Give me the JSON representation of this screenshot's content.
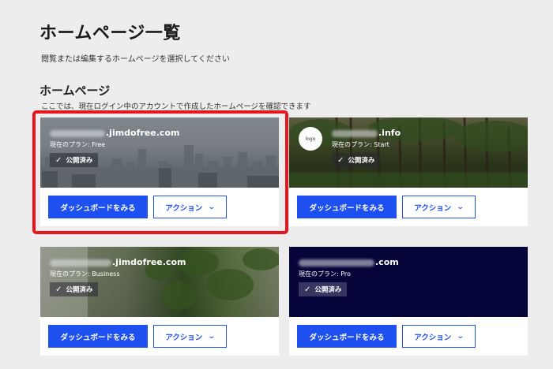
{
  "page": {
    "title": "ホームページ一覧",
    "description": "閲覧または編集するホームページを選択してください"
  },
  "section": {
    "title": "ホームページ",
    "description": "ここでは、現在ログイン中のアカウントで作成したホームページを確認できます"
  },
  "colors": {
    "accent": "#1e50f0",
    "highlight": "#e8141e",
    "background": "#ededed"
  },
  "cards": [
    {
      "domain_suffix": ".jimdofree.com",
      "plan": "現在のプラン: Free",
      "status": "公開済み",
      "dashboard_button": "ダッシュボードをみる",
      "action_button": "アクション",
      "highlighted": true
    },
    {
      "logo_text": "logo",
      "domain_suffix": ".info",
      "plan": "現在のプラン: Start",
      "status": "公開済み",
      "dashboard_button": "ダッシュボードをみる",
      "action_button": "アクション"
    },
    {
      "domain_suffix": ".jimdofree.com",
      "plan": "現在のプラン: Business",
      "status": "公開済み",
      "dashboard_button": "ダッシュボードをみる",
      "action_button": "アクション"
    },
    {
      "domain_suffix": ".com",
      "plan": "現在のプラン: Pro",
      "status": "公開済み",
      "dashboard_button": "ダッシュボードをみる",
      "action_button": "アクション"
    }
  ]
}
